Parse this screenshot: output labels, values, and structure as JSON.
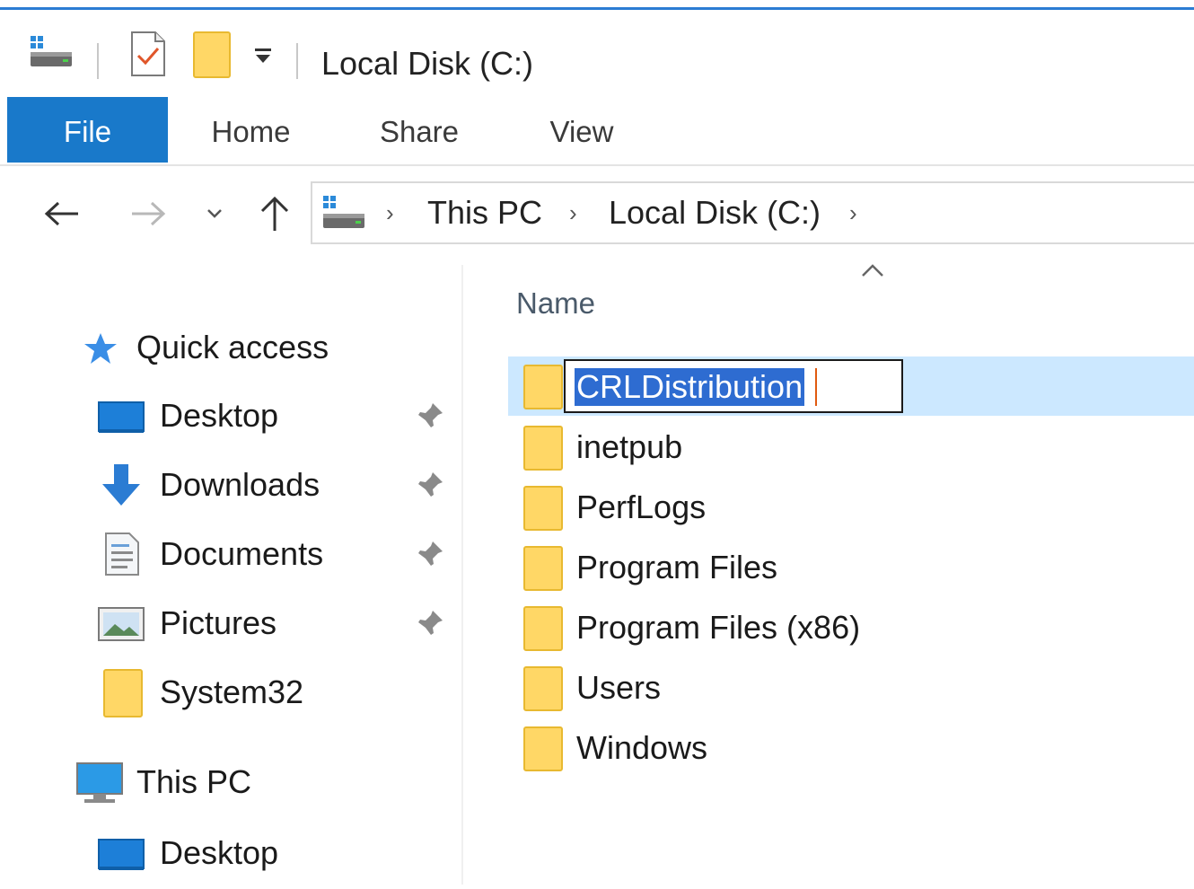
{
  "window": {
    "title": "Local Disk (C:)"
  },
  "ribbon": {
    "tabs": [
      "File",
      "Home",
      "Share",
      "View"
    ]
  },
  "address": {
    "crumbs": [
      "This PC",
      "Local Disk (C:)"
    ]
  },
  "nav_pane": {
    "quick_access_label": "Quick access",
    "quick_access_items": [
      {
        "label": "Desktop",
        "icon": "desktop-icon",
        "pinned": true
      },
      {
        "label": "Downloads",
        "icon": "downloads-icon",
        "pinned": true
      },
      {
        "label": "Documents",
        "icon": "documents-icon",
        "pinned": true
      },
      {
        "label": "Pictures",
        "icon": "pictures-icon",
        "pinned": true
      },
      {
        "label": "System32",
        "icon": "folder-icon",
        "pinned": false
      }
    ],
    "this_pc_label": "This PC",
    "this_pc_items": [
      {
        "label": "Desktop",
        "icon": "desktop-icon"
      }
    ]
  },
  "file_list": {
    "column_name": "Name",
    "sort": "ascending",
    "items": [
      "CRLDistribution",
      "inetpub",
      "PerfLogs",
      "Program Files",
      "Program Files (x86)",
      "Users",
      "Windows"
    ],
    "renaming_value": "CRLDistribution"
  },
  "colors": {
    "accent": "#1979ca",
    "selection": "#cce8ff",
    "text_selection": "#2e6cd1",
    "folder": "#ffd766"
  }
}
